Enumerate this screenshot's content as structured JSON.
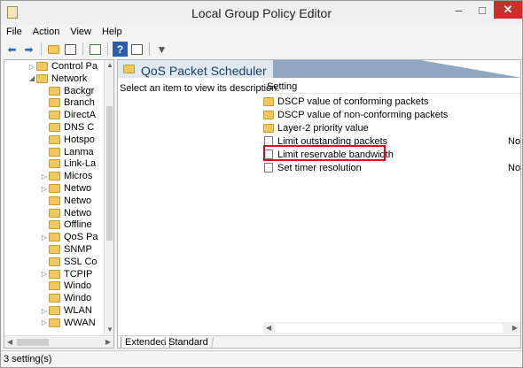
{
  "window": {
    "title": "Local Group Policy Editor",
    "min_glyph": "–",
    "max_glyph": "□",
    "close_glyph": "✕"
  },
  "menu": [
    "File",
    "Action",
    "View",
    "Help"
  ],
  "toolbar": {
    "back_glyph": "◆",
    "forward_glyph": "➡",
    "help_glyph": "?",
    "filter_glyph": "▼"
  },
  "tree": {
    "items": [
      {
        "label": "Control Pa",
        "arrow": "▷"
      },
      {
        "label": "Network",
        "arrow": "◢"
      },
      {
        "label": "Backgr",
        "arrow": ""
      },
      {
        "label": "Branch",
        "arrow": ""
      },
      {
        "label": "DirectA",
        "arrow": ""
      },
      {
        "label": "DNS C",
        "arrow": ""
      },
      {
        "label": "Hotspo",
        "arrow": ""
      },
      {
        "label": "Lanma",
        "arrow": ""
      },
      {
        "label": "Link-La",
        "arrow": ""
      },
      {
        "label": "Micros",
        "arrow": "▷"
      },
      {
        "label": "Netwo",
        "arrow": "▷"
      },
      {
        "label": "Netwo",
        "arrow": ""
      },
      {
        "label": "Netwo",
        "arrow": ""
      },
      {
        "label": "Offline",
        "arrow": ""
      },
      {
        "label": "QoS Pa",
        "arrow": "▷"
      },
      {
        "label": "SNMP",
        "arrow": ""
      },
      {
        "label": "SSL Co",
        "arrow": ""
      },
      {
        "label": "TCPIP",
        "arrow": "▷"
      },
      {
        "label": "Windo",
        "arrow": ""
      },
      {
        "label": "Windo",
        "arrow": ""
      },
      {
        "label": "WLAN",
        "arrow": "▷"
      },
      {
        "label": "WWAN",
        "arrow": "▷"
      }
    ]
  },
  "panel": {
    "title": "QoS Packet Scheduler",
    "description": "Select an item to view its description.",
    "column_setting": "Setting",
    "rows": [
      {
        "label": "DSCP value of conforming packets",
        "type": "folder",
        "state": ""
      },
      {
        "label": "DSCP value of non-conforming packets",
        "type": "folder",
        "state": ""
      },
      {
        "label": "Layer-2 priority value",
        "type": "folder",
        "state": ""
      },
      {
        "label": "Limit outstanding packets",
        "type": "policy",
        "state": "Not"
      },
      {
        "label": "Limit reservable bandwidth",
        "type": "policy",
        "state": ""
      },
      {
        "label": "Set timer resolution",
        "type": "policy",
        "state": "Not"
      }
    ],
    "highlight_color": "#e0001b"
  },
  "tabs": {
    "extended": "Extended",
    "standard": "Standard"
  },
  "status": "3 setting(s)"
}
